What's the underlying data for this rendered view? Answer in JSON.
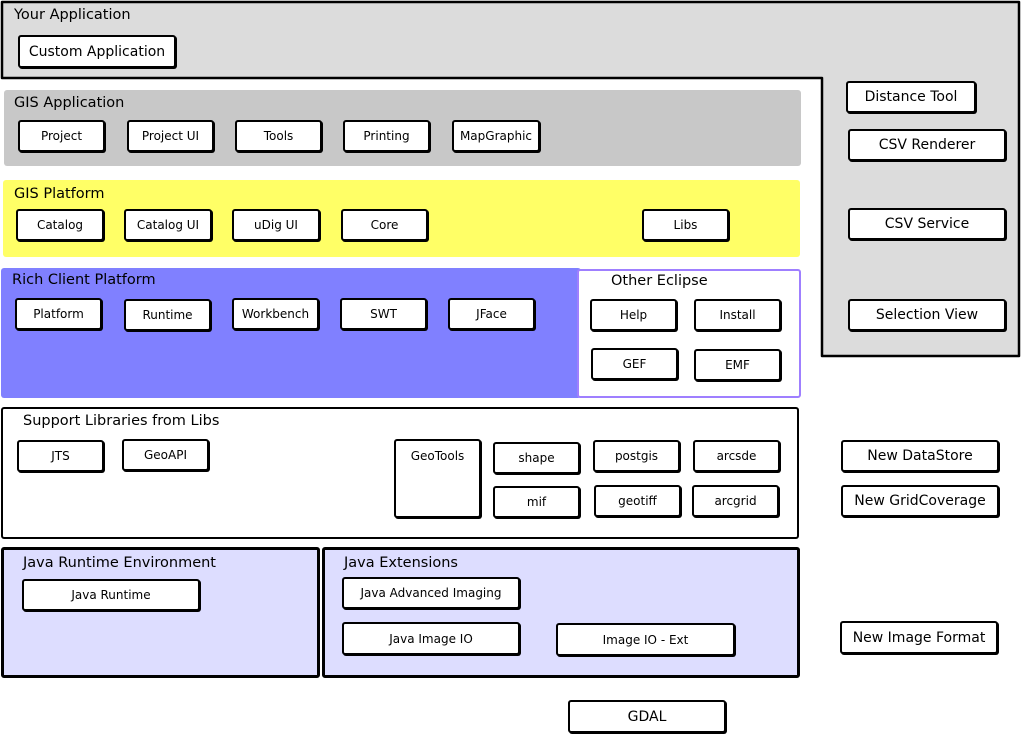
{
  "colors": {
    "your_application": "#dcdcdc",
    "gis_application": "#c8c8c8",
    "gis_platform": "#ffff66",
    "rich_client_platform": "#8080ff",
    "other_eclipse_border": "#9f7fff",
    "java_layers": "#ddddff"
  },
  "your_application": {
    "title": "Your Application",
    "custom_application": "Custom Application",
    "extensions": [
      "Distance Tool",
      "CSV Renderer",
      "CSV Service",
      "Selection View"
    ]
  },
  "gis_application": {
    "title": "GIS Application",
    "items": [
      "Project",
      "Project UI",
      "Tools",
      "Printing",
      "MapGraphic"
    ]
  },
  "gis_platform": {
    "title": "GIS Platform",
    "items": [
      "Catalog",
      "Catalog UI",
      "uDig UI",
      "Core",
      "Libs"
    ]
  },
  "rich_client_platform": {
    "title": "Rich Client Platform",
    "items": [
      "Platform",
      "Runtime",
      "Workbench",
      "SWT",
      "JFace"
    ]
  },
  "other_eclipse": {
    "title": "Other Eclipse",
    "items": [
      "Help",
      "Install",
      "GEF",
      "EMF"
    ]
  },
  "support_libraries": {
    "title": "Support Libraries from Libs",
    "items": [
      "JTS",
      "GeoAPI",
      "GeoTools",
      "shape",
      "postgis",
      "arcsde",
      "mif",
      "geotiff",
      "arcgrid"
    ]
  },
  "support_extensions": [
    "New DataStore",
    "New GridCoverage"
  ],
  "jre": {
    "title": "Java Runtime Environment",
    "items": [
      "Java Runtime"
    ]
  },
  "java_extensions": {
    "title": "Java Extensions",
    "items": [
      "Java Advanced Imaging",
      "Java Image IO",
      "Image IO - Ext"
    ]
  },
  "image_format": "New Image Format",
  "gdal": "GDAL"
}
